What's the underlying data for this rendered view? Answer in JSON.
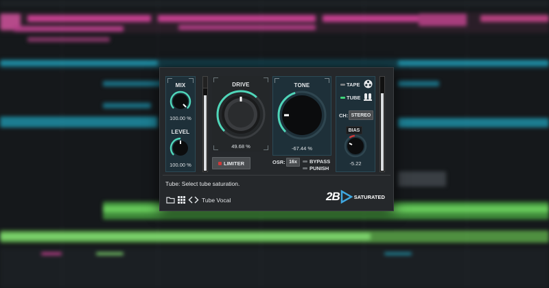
{
  "plugin": {
    "mix": {
      "label": "MIX",
      "value": "100.00 %"
    },
    "level": {
      "label": "LEVEL",
      "value": "100.00 %"
    },
    "drive": {
      "label": "DRIVE",
      "value": "49.68 %"
    },
    "limiter_label": "LIMITER",
    "tone": {
      "label": "TONE",
      "value": "-67.44 %"
    },
    "osr": {
      "label": "OSR:",
      "value": "16x"
    },
    "bypass_label": "BYPASS",
    "punish_label": "PUNISH",
    "tape_label": "TAPE",
    "tube_label": "TUBE",
    "ch_label": "CH:",
    "ch_value": "STEREO",
    "bias": {
      "label": "BIAS",
      "value": "-5.22"
    },
    "status_text": "Tube: Select tube saturation.",
    "preset_name": "Tube Vocal",
    "brand_logo": "2B",
    "brand_name": "SATURATED"
  },
  "colors": {
    "accent": "#4fd6b9",
    "panel": "#1e3039",
    "window": "#25282b",
    "led_green": "#3fd67a",
    "led_red": "#d03a3a"
  },
  "icons": [
    "folder-icon",
    "grid-icon",
    "chevron-left-icon",
    "chevron-right-icon",
    "tape-reel-icon",
    "tube-icon",
    "play-triangle-logo-icon"
  ]
}
